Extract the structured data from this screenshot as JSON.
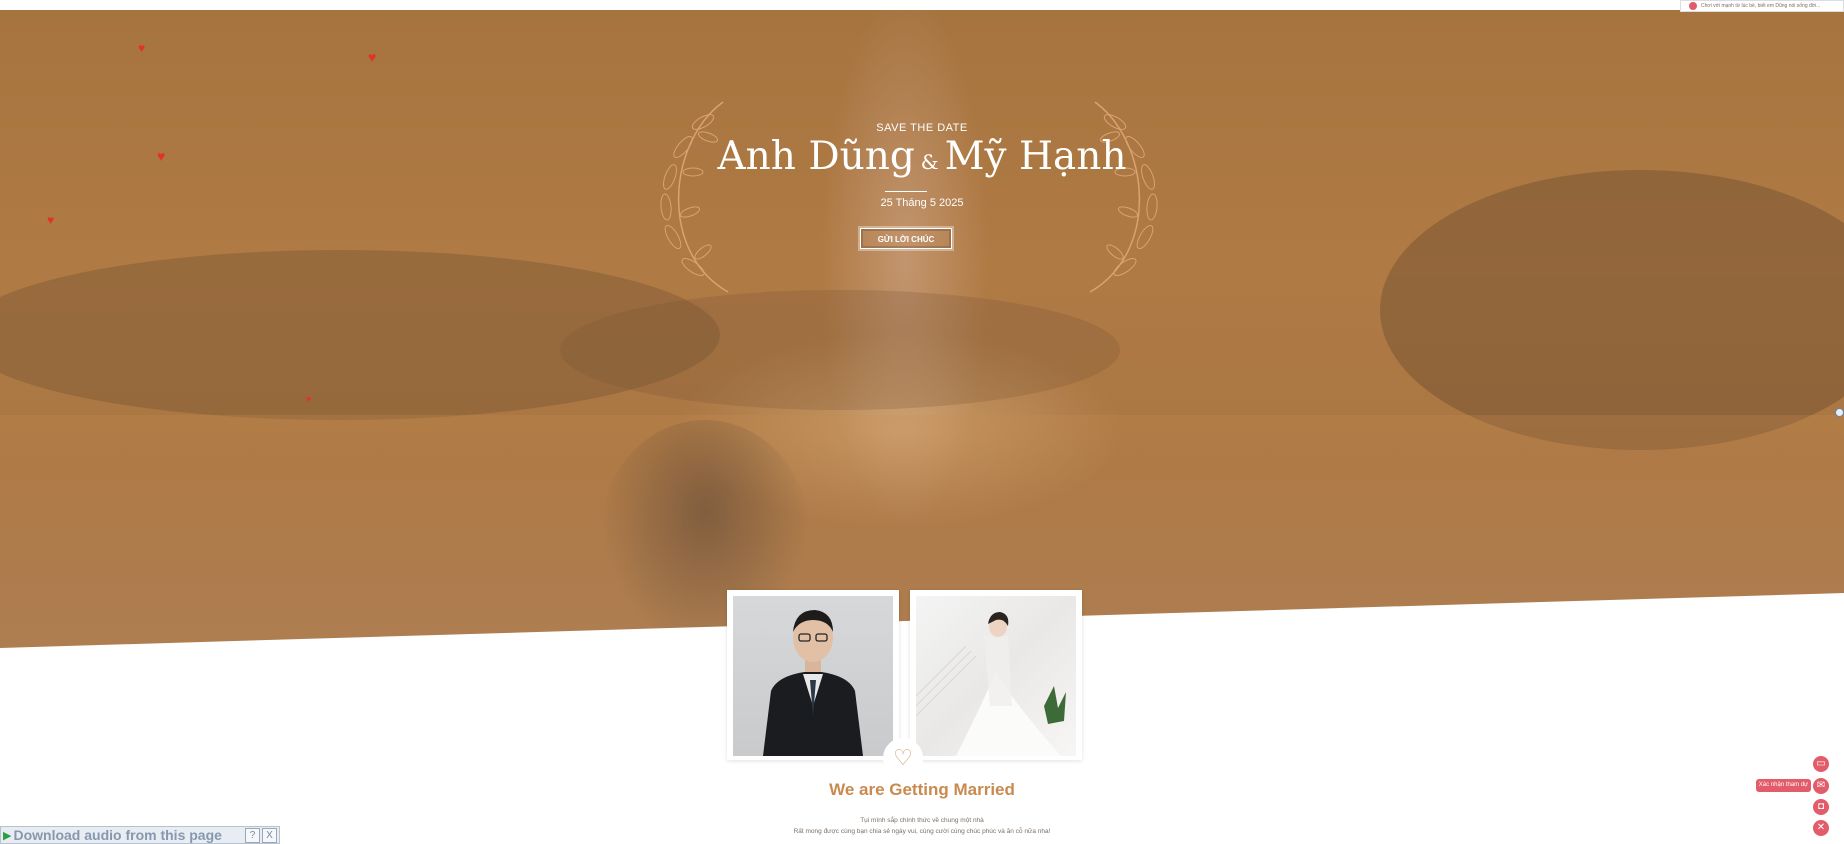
{
  "hero": {
    "save_the_date": "SAVE THE DATE",
    "groom_name": "Anh Dũng",
    "ampersand": "&",
    "bride_name": "Mỹ Hạnh",
    "date": "25 Tháng 5 2025",
    "send_wishes_label": "GỬI LỜI CHÚC"
  },
  "intro": {
    "title": "We are Getting Married",
    "line1": "Tụi mình sắp chính thức về chung một nhà",
    "line2": "Rất mong được cùng bạn chia sẻ ngày vui, cùng cười cùng chúc phúc và ăn cỗ nữa nha!"
  },
  "download_bar": {
    "label": "Download audio from this page",
    "help": "?",
    "close": "X"
  },
  "notification": {
    "text": "Chơi với mạnh từ lúc bé, biết em Dũng nói sống đời..."
  },
  "floating_actions": {
    "rsvp_label": "Xác nhận tham dự"
  },
  "colors": {
    "hero_overlay": "#a6743f",
    "accent": "#c98a4f",
    "action_red": "#e25c6a",
    "heart_red": "#e2312d"
  }
}
